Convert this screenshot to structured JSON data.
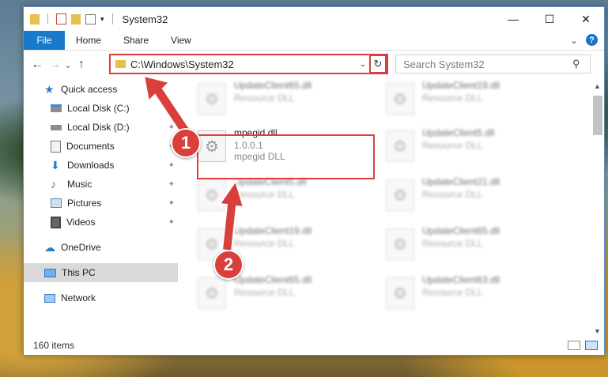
{
  "window": {
    "title": "System32",
    "minimize_glyph": "—",
    "maximize_glyph": "☐",
    "close_glyph": "✕"
  },
  "ribbon": {
    "tabs": [
      "File",
      "Home",
      "Share",
      "View"
    ],
    "expand_glyph": "⌄",
    "help_glyph": "?"
  },
  "nav": {
    "back_glyph": "←",
    "forward_glyph": "→",
    "recent_glyph": "⌄",
    "up_glyph": "↑",
    "address_path": "C:\\Windows\\System32",
    "address_dropdown_glyph": "⌄",
    "refresh_glyph": "↻",
    "search_placeholder": "Search System32",
    "search_glyph": "⚲"
  },
  "sidebar": {
    "items": [
      {
        "label": "Quick access",
        "icon": "star-icon"
      },
      {
        "label": "Local Disk (C:)",
        "icon": "drive-icon"
      },
      {
        "label": "Local Disk (D:)",
        "icon": "drive-icon"
      },
      {
        "label": "Documents",
        "icon": "documents-icon"
      },
      {
        "label": "Downloads",
        "icon": "download-icon"
      },
      {
        "label": "Music",
        "icon": "music-icon"
      },
      {
        "label": "Pictures",
        "icon": "pictures-icon"
      },
      {
        "label": "Videos",
        "icon": "videos-icon"
      },
      {
        "label": "OneDrive",
        "icon": "cloud-icon"
      },
      {
        "label": "This PC",
        "icon": "computer-icon"
      },
      {
        "label": "Network",
        "icon": "network-icon"
      }
    ],
    "pin_glyph": "📌"
  },
  "files": {
    "left": [
      {
        "name": "UpdateClient65.dll",
        "type": "Resource DLL"
      },
      {
        "name": "mpegid.dll",
        "version": "1.0.0.1",
        "type": "mpegid DLL"
      },
      {
        "name": "UpdateClient5.dll",
        "type": "Resource DLL"
      },
      {
        "name": "UpdateClient19.dll",
        "type": "Resource DLL"
      },
      {
        "name": "UpdateClient65.dll",
        "type": "Resource DLL"
      }
    ],
    "right": [
      {
        "name": "UpdateClient19.dll",
        "type": "Resource DLL"
      },
      {
        "name": "UpdateClient5.dll",
        "type": "Resource DLL"
      },
      {
        "name": "UpdateClient21.dll",
        "type": "Resource DLL"
      },
      {
        "name": "UpdateClient65.dll",
        "type": "Resource DLL"
      },
      {
        "name": "UpdateClient63.dll",
        "type": "Resource DLL"
      }
    ],
    "file_icon_glyph": "⚙"
  },
  "annotations": {
    "badge_1": "1",
    "badge_2": "2",
    "highlight_color": "#d9403b"
  },
  "scroll": {
    "up_glyph": "▲",
    "down_glyph": "▼"
  },
  "status": {
    "item_count": "160 items"
  },
  "colors": {
    "accent": "#1979ca",
    "annotation_red": "#d9403b"
  }
}
